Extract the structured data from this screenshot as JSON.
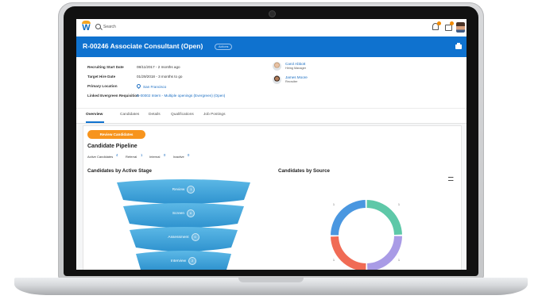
{
  "topbar": {
    "logo": "W",
    "search_placeholder": "Search",
    "bell_icon": "bell-icon",
    "inbox_icon": "inbox-icon"
  },
  "header": {
    "title": "R-00246 Associate Consultant (Open)",
    "status": "Actions",
    "print_icon": "print-icon"
  },
  "details": {
    "recruiting_start": {
      "label": "Recruiting Start Date",
      "value": "08/11/2017 - 2 months ago"
    },
    "target_hire": {
      "label": "Target Hire Date",
      "value": "01/29/2018 - 3 months to go"
    },
    "primary_location": {
      "label": "Primary Location",
      "value": "San Francisco"
    },
    "linked_requisition": {
      "label": "Linked Evergreen Requisition",
      "value": "E-00002 Intern - Multiple openings (Evergreen) (Open)"
    }
  },
  "people": [
    {
      "name": "Carol Abbott",
      "role": "Hiring Manager"
    },
    {
      "name": "James Moore",
      "role": "Recruiter"
    }
  ],
  "tabs": [
    "Overview",
    "Candidates",
    "Details",
    "Qualifications",
    "Job Postings"
  ],
  "overview": {
    "review_button": "Review Candidates",
    "pipeline_title": "Candidate Pipeline",
    "stats": [
      {
        "label": "Active Candidates",
        "value": "4"
      },
      {
        "label": "Referral",
        "value": "1"
      },
      {
        "label": "Internal",
        "value": "0"
      },
      {
        "label": "Inactive",
        "value": "0"
      }
    ],
    "stage_title": "Candidates by Active Stage",
    "source_title": "Candidates by Source",
    "stages": [
      {
        "label": "Review",
        "count": "1"
      },
      {
        "label": "Screen",
        "count": "0"
      },
      {
        "label": "Assessment",
        "count": "0"
      },
      {
        "label": "Interview",
        "count": "2"
      }
    ],
    "source_chart": {
      "type": "pie",
      "slices": [
        {
          "value": 1,
          "color": "#5ec8a8"
        },
        {
          "value": 1,
          "color": "#a99be6"
        },
        {
          "value": 1,
          "color": "#f06b55"
        },
        {
          "value": 1,
          "color": "#4a97e0"
        }
      ],
      "labels": [
        "1",
        "1",
        "1",
        "1"
      ],
      "legend_icon": "legend-icon"
    }
  },
  "colors": {
    "brand_blue": "#0f72cf",
    "accent_orange": "#f7941d",
    "funnel_blue": "#3da2d9"
  }
}
